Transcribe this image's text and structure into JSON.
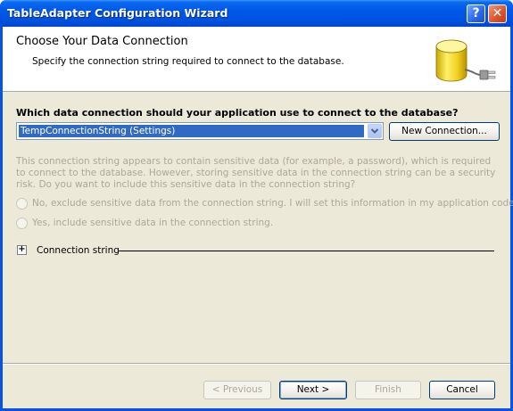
{
  "window": {
    "title": "TableAdapter Configuration Wizard",
    "help_glyph": "?",
    "close_glyph": "✕"
  },
  "header": {
    "title": "Choose Your Data Connection",
    "description": "Specify the connection string required to connect to the database.",
    "icon": "database-plug-icon"
  },
  "connection": {
    "question": "Which data connection should your application use to connect to the database?",
    "selected": "TempConnectionString (Settings)",
    "new_connection_label": "New Connection..."
  },
  "sensitive": {
    "message": "This connection string appears to contain sensitive data (for example, a password), which is required to connect to the database. However, storing sensitive data in the connection string can be a security risk. Do you want to include this sensitive data in the connection string?",
    "option_no": "No, exclude sensitive data from the connection string. I will set this information in my application code.",
    "option_yes": "Yes, include sensitive data in the connection string."
  },
  "connection_string": {
    "label": "Connection string",
    "expander_glyph": "+"
  },
  "footer": {
    "previous_label": "< Previous",
    "next_label": "Next >",
    "finish_label": "Finish",
    "cancel_label": "Cancel"
  },
  "colors": {
    "title_bar": "#0054e3",
    "selection": "#316ac5",
    "dialog_bg": "#ece9d8",
    "disabled_text": "#aca899"
  }
}
